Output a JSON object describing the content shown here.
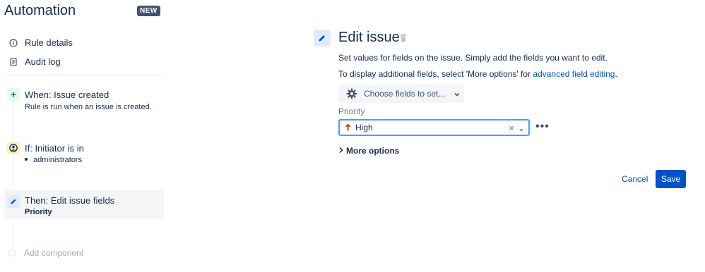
{
  "sidebar": {
    "title": "Automation",
    "badge": "NEW",
    "nav": [
      {
        "label": "Rule details",
        "icon": "info-icon"
      },
      {
        "label": "Audit log",
        "icon": "document-icon"
      }
    ],
    "components": {
      "trigger": {
        "title": "When: Issue created",
        "subtitle": "Rule is run when an issue is created.",
        "icon": "plus-icon"
      },
      "condition": {
        "title": "If: Initiator is in",
        "subtitle": "administrators",
        "icon": "user-circle-icon"
      },
      "action": {
        "title": "Then: Edit issue fields",
        "subtitle": "Priority",
        "icon": "pencil-icon"
      }
    },
    "add_component": "Add component"
  },
  "main": {
    "title": "Edit issue",
    "description": "Set values for fields on the issue. Simply add the fields you want to edit.",
    "description2_prefix": "To display additional fields, select 'More options' for ",
    "description2_link": "advanced field editing",
    "description2_suffix": ".",
    "choose_fields": "Choose fields to set...",
    "field_label": "Priority",
    "priority_value": "High",
    "more_options": "More options",
    "cancel": "Cancel",
    "save": "Save"
  },
  "colors": {
    "primary": "#0052cc",
    "focus_border": "#4c9aff",
    "priority_high": "#de350b",
    "trigger_bg": "#e3fcef",
    "condition_bg": "#fff0b3",
    "action_bg": "#deebff",
    "badge_bg": "#42526e"
  }
}
